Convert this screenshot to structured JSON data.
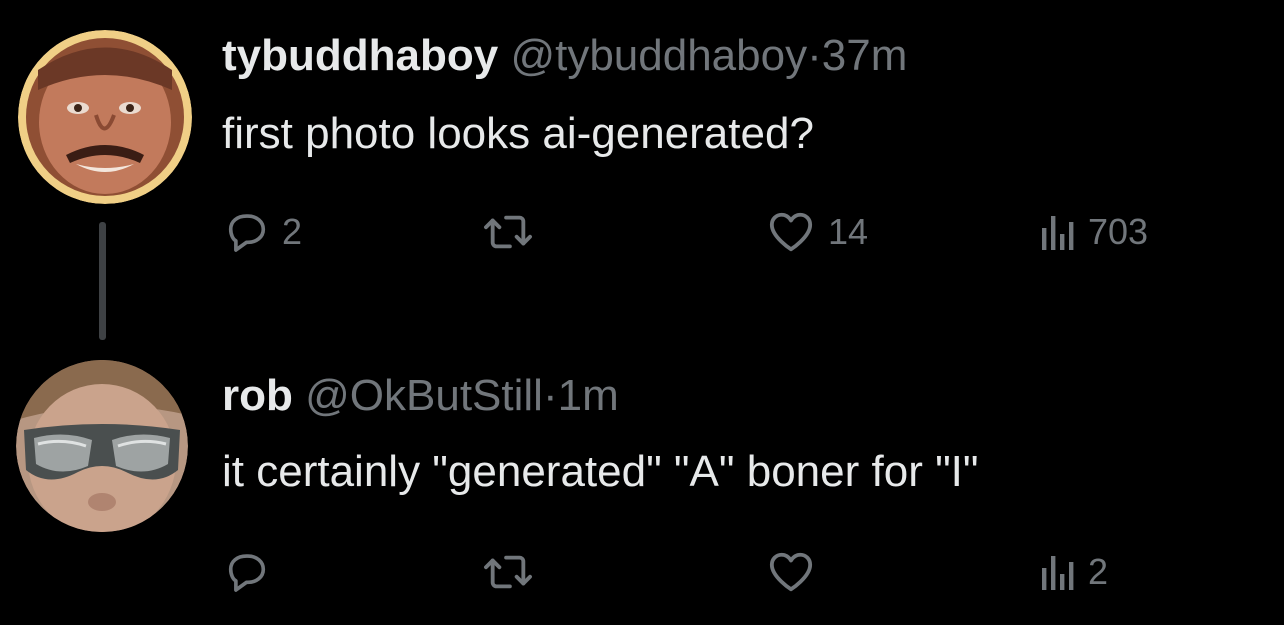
{
  "thread": {
    "tweets": [
      {
        "display_name": "tybuddhaboy",
        "handle": "@tybuddhaboy",
        "separator": "·",
        "time": "37m",
        "text": "first photo looks ai-generated?",
        "avatar_icon": "profile-photo-icon",
        "actions": {
          "reply": {
            "icon": "reply-icon",
            "count": "2"
          },
          "retweet": {
            "icon": "retweet-icon",
            "count": ""
          },
          "like": {
            "icon": "heart-icon",
            "count": "14"
          },
          "views": {
            "icon": "views-chart-icon",
            "count": "703"
          }
        }
      },
      {
        "display_name": "rob",
        "handle": "@OkButStill",
        "separator": "·",
        "time": "1m",
        "text": "it certainly \"generated\" \"A\" boner for \"I\"",
        "avatar_icon": "profile-photo-icon",
        "actions": {
          "reply": {
            "icon": "reply-icon",
            "count": ""
          },
          "retweet": {
            "icon": "retweet-icon",
            "count": ""
          },
          "like": {
            "icon": "heart-icon",
            "count": ""
          },
          "views": {
            "icon": "views-chart-icon",
            "count": "2"
          }
        }
      }
    ]
  },
  "colors": {
    "background": "#000000",
    "primary_text": "#e7e9ea",
    "secondary_text": "#71767b",
    "thread_line": "#3e4144"
  }
}
